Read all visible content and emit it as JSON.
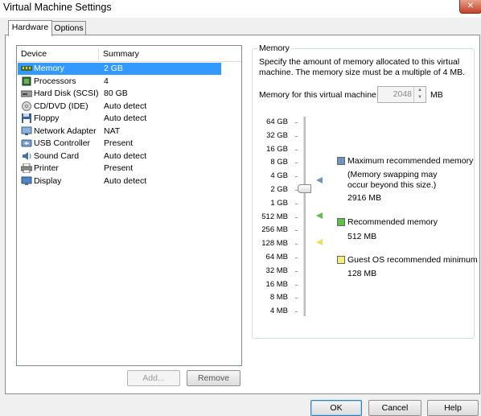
{
  "window": {
    "title": "Virtual Machine Settings"
  },
  "tabs": [
    {
      "label": "Hardware"
    },
    {
      "label": "Options"
    }
  ],
  "device_list": {
    "headers": [
      "Device",
      "Summary"
    ],
    "rows": [
      {
        "device": "Memory",
        "summary": "2 GB",
        "icon": "memory-icon"
      },
      {
        "device": "Processors",
        "summary": "4",
        "icon": "processor-icon"
      },
      {
        "device": "Hard Disk (SCSI)",
        "summary": "80 GB",
        "icon": "hard-disk-icon"
      },
      {
        "device": "CD/DVD (IDE)",
        "summary": "Auto detect",
        "icon": "cd-dvd-icon"
      },
      {
        "device": "Floppy",
        "summary": "Auto detect",
        "icon": "floppy-icon"
      },
      {
        "device": "Network Adapter",
        "summary": "NAT",
        "icon": "network-adapter-icon"
      },
      {
        "device": "USB Controller",
        "summary": "Present",
        "icon": "usb-icon"
      },
      {
        "device": "Sound Card",
        "summary": "Auto detect",
        "icon": "sound-card-icon"
      },
      {
        "device": "Printer",
        "summary": "Present",
        "icon": "printer-icon"
      },
      {
        "device": "Display",
        "summary": "Auto detect",
        "icon": "display-icon"
      }
    ],
    "add_label": "Add...",
    "remove_label": "Remove"
  },
  "memory": {
    "group_title": "Memory",
    "description": "Specify the amount of memory allocated to this virtual machine. The memory size must be a multiple of 4 MB.",
    "field_label": "Memory for this virtual machine:",
    "value": "2048",
    "unit": "MB",
    "scale": [
      "64 GB",
      "32 GB",
      "16 GB",
      "8 GB",
      "4 GB",
      "2 GB",
      "1 GB",
      "512 MB",
      "256 MB",
      "128 MB",
      "64 MB",
      "32 MB",
      "16 MB",
      "8 MB",
      "4 MB"
    ],
    "legend": [
      {
        "label": "Maximum recommended memory",
        "note": "(Memory swapping may occur beyond this size.)",
        "value": "2916 MB",
        "color": "#6f93bf"
      },
      {
        "label": "Recommended memory",
        "value": "512 MB",
        "color": "#5fbf4a"
      },
      {
        "label": "Guest OS recommended minimum",
        "value": "128 MB",
        "color": "#f2ee7a"
      }
    ]
  },
  "footer": {
    "ok_label": "OK",
    "cancel_label": "Cancel",
    "help_label": "Help"
  }
}
